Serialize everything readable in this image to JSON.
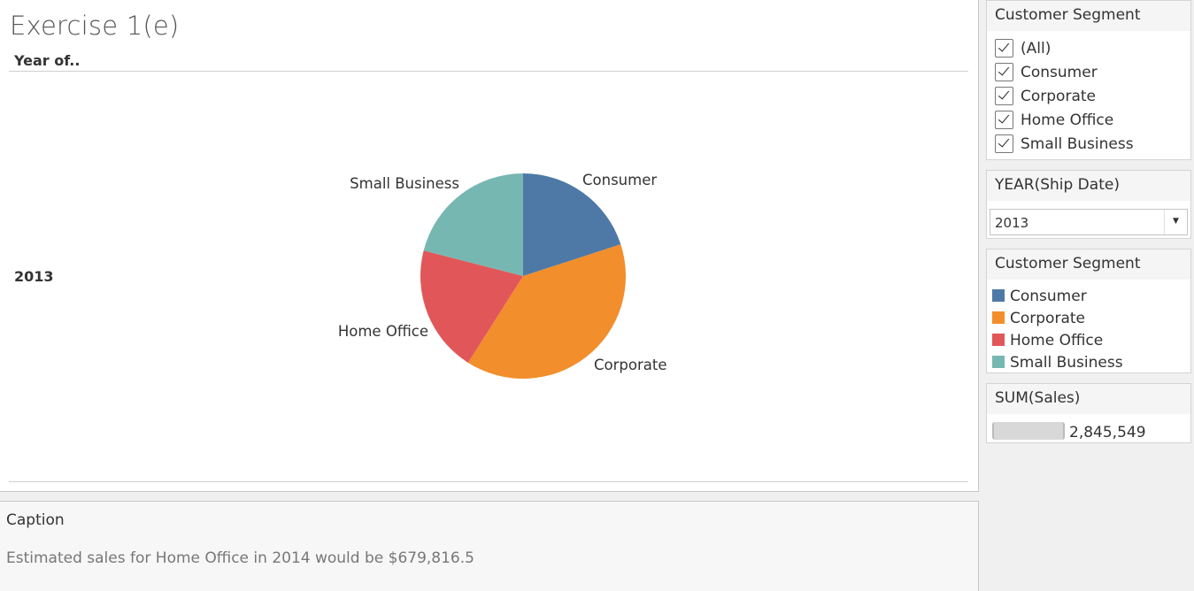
{
  "sheet": {
    "title": "Exercise 1(e)",
    "row_header": "Year of..",
    "row_value": "2013"
  },
  "chart_data": {
    "type": "pie",
    "categories": [
      "Consumer",
      "Corporate",
      "Home Office",
      "Small Business"
    ],
    "values": [
      20,
      39,
      20,
      21
    ],
    "colors": [
      "#4e79a7",
      "#f28e2b",
      "#e15759",
      "#76b7b2"
    ],
    "labels": [
      "Consumer",
      "Corporate",
      "Home Office",
      "Small Business"
    ]
  },
  "caption": {
    "title": "Caption",
    "text": "Estimated sales for Home Office in 2014 would be $679,816.5"
  },
  "segment_filter": {
    "title": "Customer Segment",
    "items": [
      {
        "label": "(All)",
        "checked": true
      },
      {
        "label": "Consumer",
        "checked": true
      },
      {
        "label": "Corporate",
        "checked": true
      },
      {
        "label": "Home Office",
        "checked": true
      },
      {
        "label": "Small Business",
        "checked": true
      }
    ]
  },
  "year_filter": {
    "title": "YEAR(Ship Date)",
    "selected": "2013",
    "arrow_icon": "caret-down-icon"
  },
  "color_legend": {
    "title": "Customer Segment",
    "items": [
      {
        "label": "Consumer",
        "color": "#4e79a7"
      },
      {
        "label": "Corporate",
        "color": "#f28e2b"
      },
      {
        "label": "Home Office",
        "color": "#e15759"
      },
      {
        "label": "Small Business",
        "color": "#76b7b2"
      }
    ]
  },
  "size_legend": {
    "title": "SUM(Sales)",
    "value": "2,845,549"
  }
}
